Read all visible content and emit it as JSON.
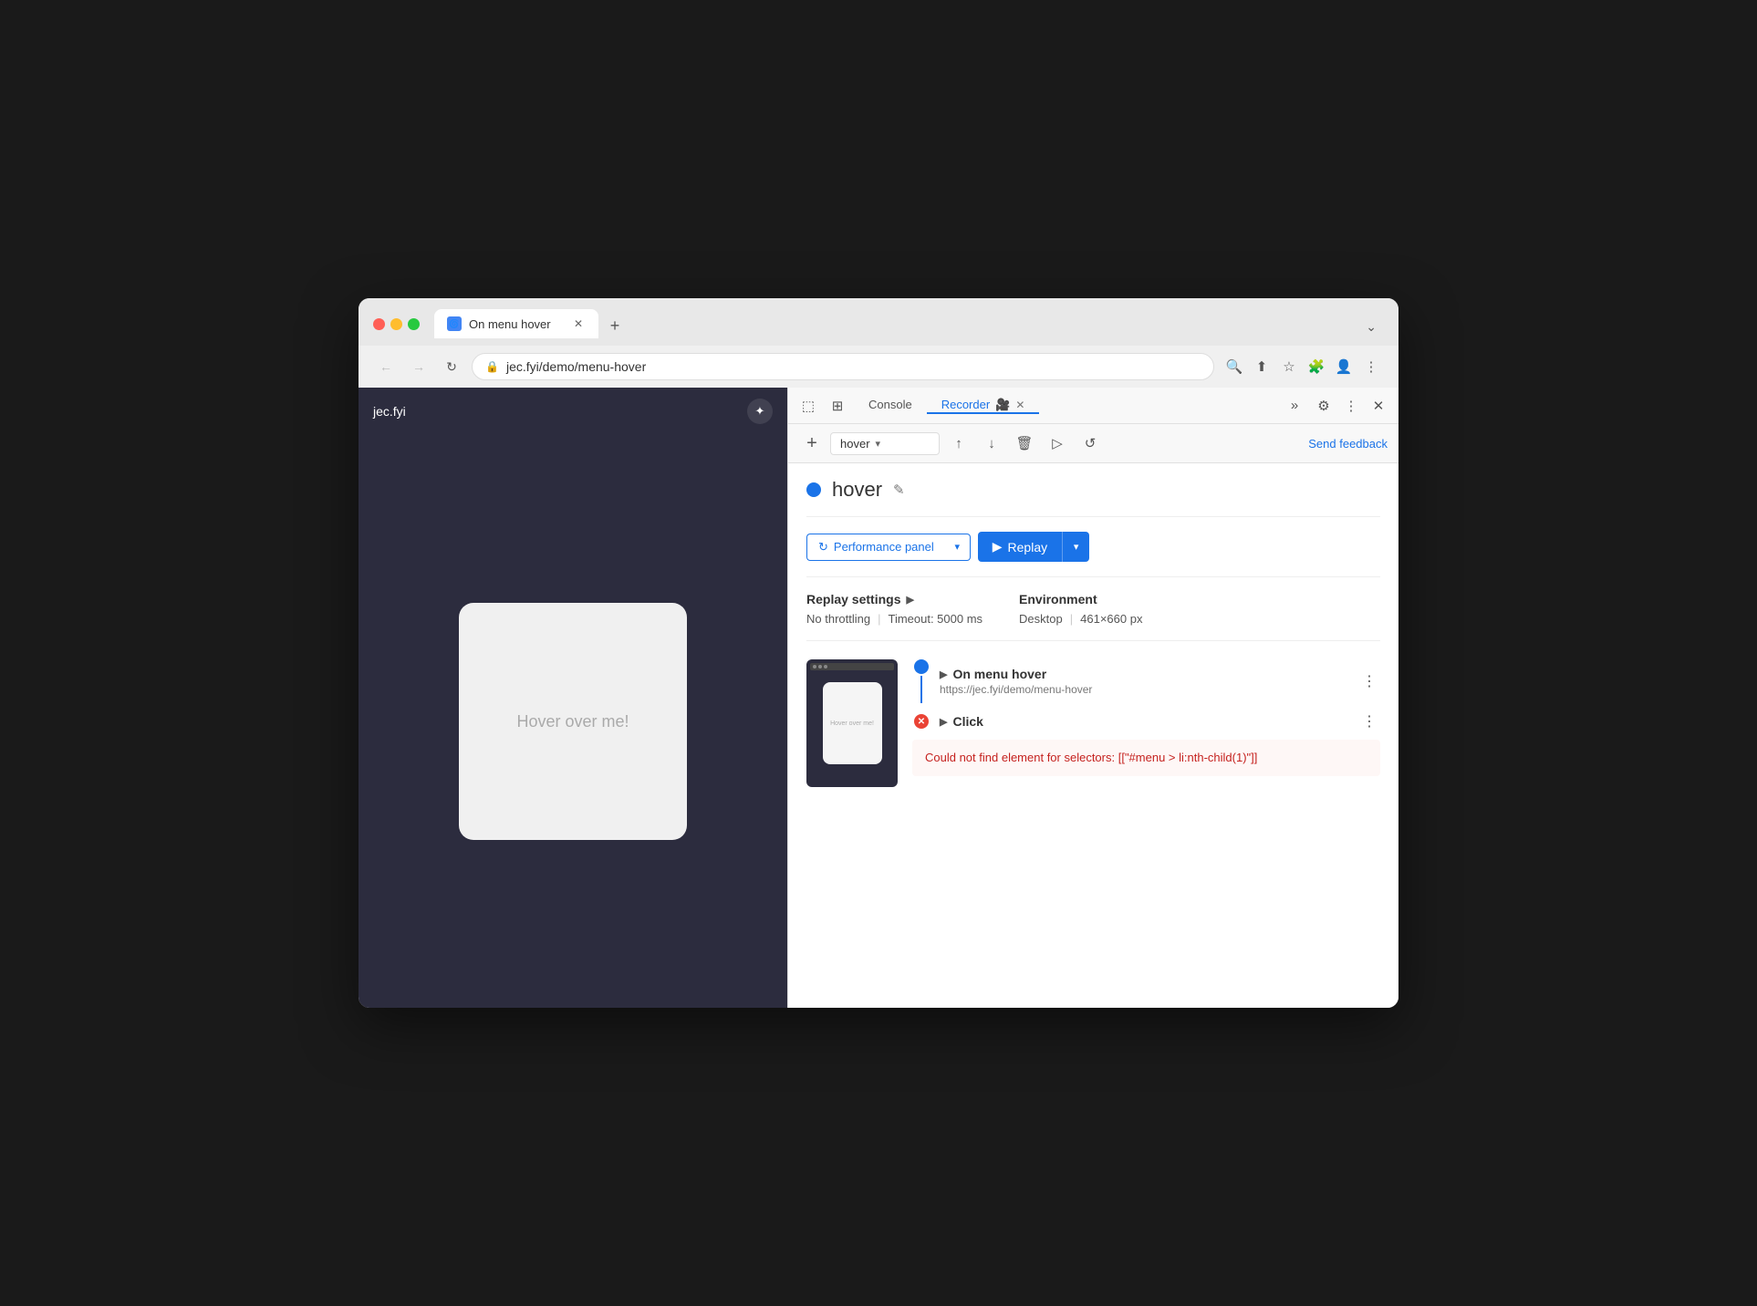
{
  "browser": {
    "tab": {
      "title": "On menu hover",
      "favicon": "🔵"
    },
    "address": "jec.fyi/demo/menu-hover",
    "new_tab_label": "+",
    "expand_label": "⌄"
  },
  "nav": {
    "back": "←",
    "forward": "→",
    "refresh": "↻"
  },
  "devtools": {
    "tabs": [
      {
        "label": "Console",
        "active": false
      },
      {
        "label": "Recorder",
        "active": true
      }
    ],
    "more_tabs": "»",
    "settings_icon": "⚙",
    "more_options_icon": "⋮",
    "close_icon": "✕"
  },
  "recorder": {
    "add_button": "+",
    "recording_name": "hover",
    "export_icon": "↑",
    "import_icon": "↓",
    "delete_icon": "🗑",
    "play_icon": "▷",
    "slow_play_icon": "↺",
    "send_feedback": "Send feedback",
    "title_dot_color": "#1a73e8",
    "recording_title": "hover",
    "edit_icon": "✎",
    "performance_panel_label": "Performance panel",
    "replay_label": "Replay",
    "performance_panel_icon": "↻",
    "replay_icon": "▶",
    "dropdown_arrow": "▾",
    "settings": {
      "title": "Replay settings",
      "arrow": "▶",
      "throttling": "No throttling",
      "timeout": "Timeout: 5000 ms",
      "environment_title": "Environment",
      "environment_value": "Desktop",
      "resolution": "461×660 px"
    },
    "steps": [
      {
        "id": "step-navigate",
        "icon_type": "blue",
        "title": "On menu hover",
        "url": "https://jec.fyi/demo/menu-hover",
        "has_line": true,
        "error": null
      },
      {
        "id": "step-click",
        "icon_type": "red",
        "title": "Click",
        "url": null,
        "has_line": false,
        "error": "Could not find element for selectors: [[\"#menu > li:nth-child(1)\"]]"
      }
    ]
  },
  "webpage": {
    "logo": "jec.fyi",
    "hover_text": "Hover over me!"
  }
}
